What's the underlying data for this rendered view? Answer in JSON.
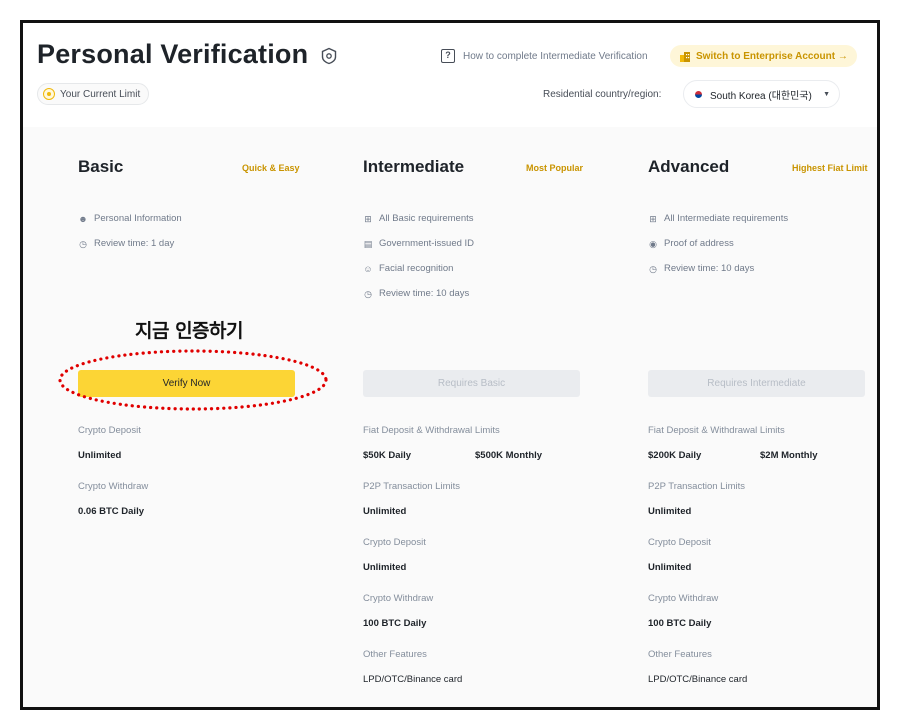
{
  "header": {
    "title": "Personal Verification",
    "current_limit": "Your Current Limit",
    "howto": "How to complete Intermediate Verification",
    "enterprise": "Switch to Enterprise Account →",
    "residence_label": "Residential country/region:",
    "country": "South Korea (대한민국)",
    "icons": [
      "shield-icon",
      "coin-icon",
      "document-icon",
      "building-icon",
      "korea-flag-icon",
      "chevron-down-icon"
    ]
  },
  "annotation": {
    "text": "지금 인증하기",
    "color": "#e00000"
  },
  "colors": {
    "accent": "#fcd535",
    "tag": "#c99400",
    "disabled": "#eaecef"
  },
  "tiers": [
    {
      "name": "Basic",
      "tag": "Quick & Easy",
      "requirements": [
        "Personal Information",
        "Review time: 1 day"
      ],
      "cta": "Verify Now",
      "limits": [
        {
          "label": "Crypto Deposit",
          "values": [
            "Unlimited"
          ]
        },
        {
          "label": "Crypto Withdraw",
          "values": [
            "0.06 BTC Daily"
          ]
        }
      ]
    },
    {
      "name": "Intermediate",
      "tag": "Most Popular",
      "requirements": [
        "All Basic requirements",
        "Government-issued ID",
        "Facial recognition",
        "Review time: 10 days"
      ],
      "cta": "Requires Basic",
      "limits": [
        {
          "label": "Fiat Deposit & Withdrawal Limits",
          "values": [
            "$50K Daily",
            "$500K Monthly"
          ]
        },
        {
          "label": "P2P Transaction Limits",
          "values": [
            "Unlimited"
          ]
        },
        {
          "label": "Crypto Deposit",
          "values": [
            "Unlimited"
          ]
        },
        {
          "label": "Crypto Withdraw",
          "values": [
            "100 BTC Daily"
          ]
        },
        {
          "label": "Other Features",
          "values": [
            "LPD/OTC/Binance card"
          ]
        }
      ]
    },
    {
      "name": "Advanced",
      "tag": "Highest Fiat Limit",
      "requirements": [
        "All Intermediate requirements",
        "Proof of address",
        "Review time: 10 days"
      ],
      "cta": "Requires Intermediate",
      "limits": [
        {
          "label": "Fiat Deposit & Withdrawal Limits",
          "values": [
            "$200K Daily",
            "$2M Monthly"
          ]
        },
        {
          "label": "P2P Transaction Limits",
          "values": [
            "Unlimited"
          ]
        },
        {
          "label": "Crypto Deposit",
          "values": [
            "Unlimited"
          ]
        },
        {
          "label": "Crypto Withdraw",
          "values": [
            "100 BTC Daily"
          ]
        },
        {
          "label": "Other Features",
          "values": [
            "LPD/OTC/Binance card"
          ]
        }
      ]
    }
  ]
}
